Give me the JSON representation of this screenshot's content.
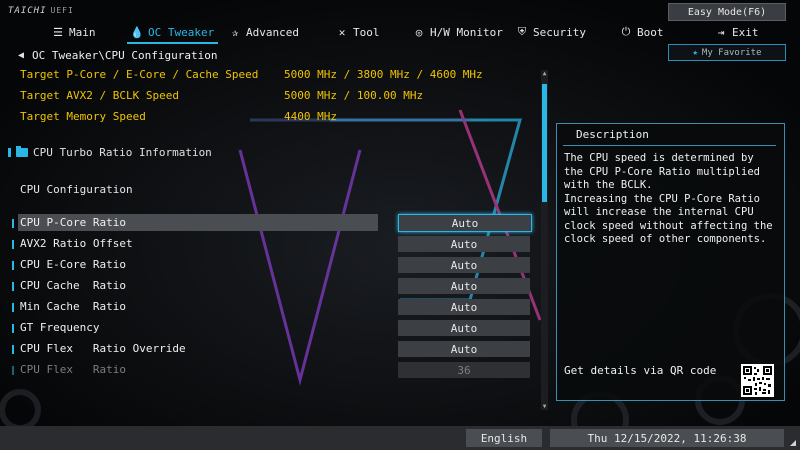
{
  "brand": {
    "logo": "TAICHI",
    "sub": "UEFI"
  },
  "easy_mode": "Easy Mode(F6)",
  "nav": [
    {
      "label": "Main",
      "icon": "menu-icon"
    },
    {
      "label": "OC Tweaker",
      "icon": "droplet-icon"
    },
    {
      "label": "Advanced",
      "icon": "star-arrow-icon"
    },
    {
      "label": "Tool",
      "icon": "tools-icon"
    },
    {
      "label": "H/W Monitor",
      "icon": "monitor-icon"
    },
    {
      "label": "Security",
      "icon": "shield-icon"
    },
    {
      "label": "Boot",
      "icon": "power-icon"
    },
    {
      "label": "Exit",
      "icon": "exit-icon"
    }
  ],
  "favorite": "My Favorite",
  "breadcrumb": "OC Tweaker\\CPU Configuration",
  "info": [
    {
      "label": "Target P-Core / E-Core / Cache Speed",
      "value": "5000 MHz / 3800 MHz / 4600 MHz"
    },
    {
      "label": "Target AVX2 / BCLK Speed",
      "value": "5000 MHz / 100.00 MHz"
    },
    {
      "label": "Target Memory Speed",
      "value": "4400 MHz"
    }
  ],
  "submenu": "CPU Turbo Ratio Information",
  "section": "CPU Configuration",
  "settings": [
    {
      "label": "CPU P-Core Ratio",
      "value": "Auto"
    },
    {
      "label": "AVX2 Ratio Offset",
      "value": "Auto"
    },
    {
      "label": "CPU E-Core Ratio",
      "value": "Auto"
    },
    {
      "label": "CPU Cache  Ratio",
      "value": "Auto"
    },
    {
      "label": "Min Cache  Ratio",
      "value": "Auto"
    },
    {
      "label": "GT Frequency",
      "value": "Auto"
    },
    {
      "label": "CPU Flex   Ratio Override",
      "value": "Auto"
    },
    {
      "label": "CPU Flex   Ratio",
      "value": "36"
    }
  ],
  "description": {
    "title": "Description",
    "text": "The CPU speed is determined by the CPU P-Core Ratio multiplied with the BCLK.\nIncreasing the CPU P-Core Ratio will increase the internal CPU clock speed without affecting the clock speed of other components.",
    "qr_label": "Get details via QR code"
  },
  "language": "English",
  "datetime": "Thu 12/15/2022, 11:26:38"
}
